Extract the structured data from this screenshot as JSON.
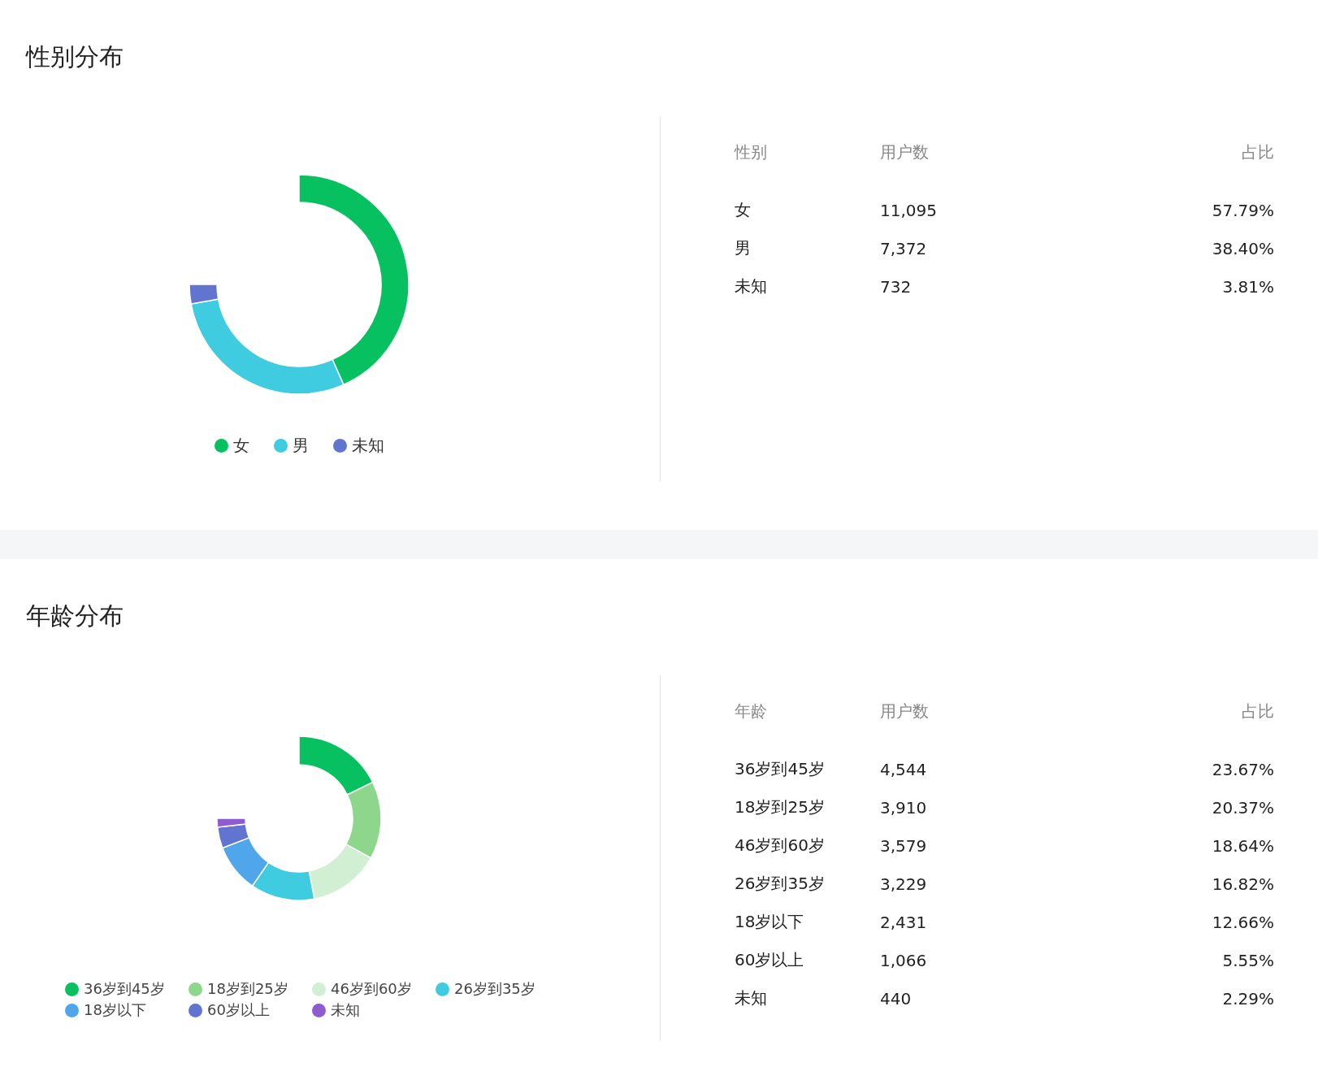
{
  "sections": [
    {
      "title": "性别分布",
      "chart_data": {
        "type": "donut",
        "categories": [
          "女",
          "男",
          "未知"
        ],
        "values": [
          57.79,
          38.4,
          3.81
        ]
      },
      "legend": [
        {
          "color": "#07c160"
        },
        {
          "color": "#40cce0"
        },
        {
          "color": "#6074d0"
        }
      ],
      "table": {
        "columns": [
          "性别",
          "用户数",
          "占比"
        ],
        "rows": [
          [
            "女",
            "11,095",
            "57.79%"
          ],
          [
            "男",
            "7,372",
            "38.40%"
          ],
          [
            "未知",
            "732",
            "3.81%"
          ]
        ]
      }
    },
    {
      "title": "年龄分布",
      "chart_data": {
        "type": "donut",
        "categories": [
          "36岁到45岁",
          "18岁到25岁",
          "46岁到60岁",
          "26岁到35岁",
          "18岁以下",
          "60岁以上",
          "未知"
        ],
        "values": [
          23.67,
          20.37,
          18.64,
          16.82,
          12.66,
          5.55,
          2.29
        ]
      },
      "legend": [
        {
          "color": "#07c160"
        },
        {
          "color": "#8ed68c"
        },
        {
          "color": "#d1efd2"
        },
        {
          "color": "#40cce0"
        },
        {
          "color": "#4fa6ea"
        },
        {
          "color": "#6074d0"
        },
        {
          "color": "#8e5ccf"
        }
      ],
      "table": {
        "columns": [
          "年龄",
          "用户数",
          "占比"
        ],
        "rows": [
          [
            "36岁到45岁",
            "4,544",
            "23.67%"
          ],
          [
            "18岁到25岁",
            "3,910",
            "20.37%"
          ],
          [
            "46岁到60岁",
            "3,579",
            "18.64%"
          ],
          [
            "26岁到35岁",
            "3,229",
            "16.82%"
          ],
          [
            "18岁以下",
            "2,431",
            "12.66%"
          ],
          [
            "60岁以上",
            "1,066",
            "5.55%"
          ],
          [
            "未知",
            "440",
            "2.29%"
          ]
        ]
      }
    }
  ]
}
